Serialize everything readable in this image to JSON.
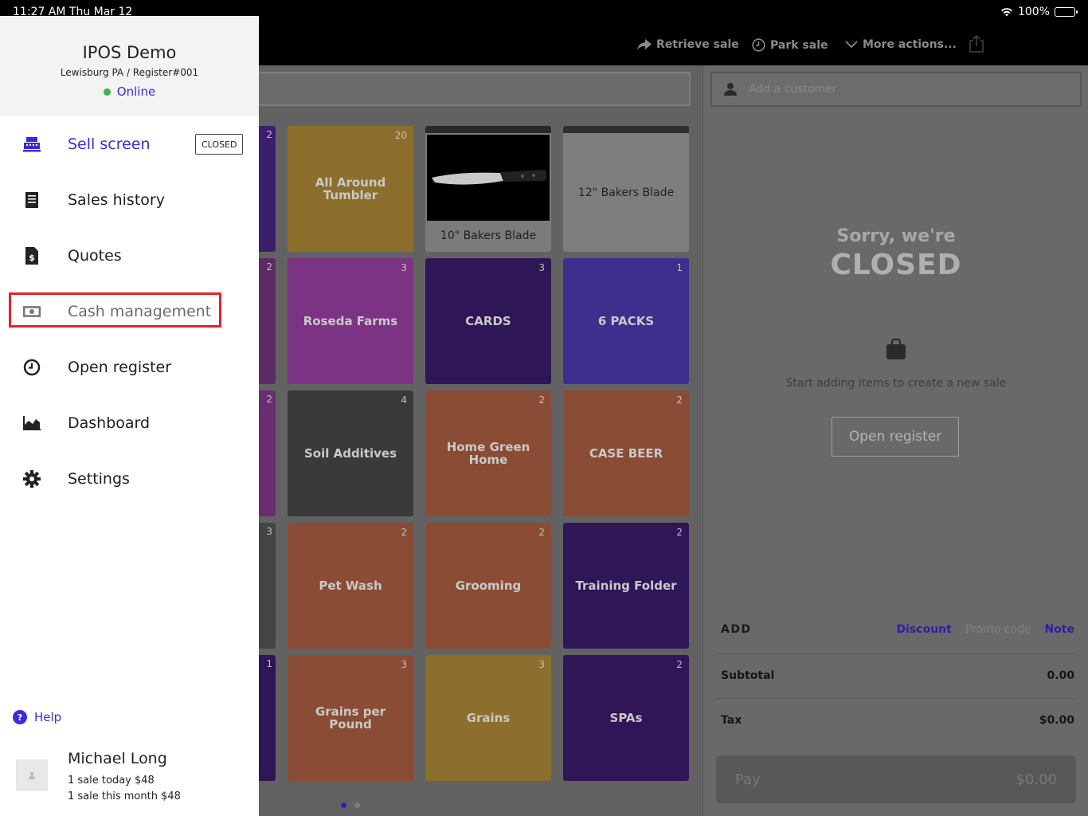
{
  "status_bar": {
    "time": "11:27 AM   Thu Mar 12",
    "battery": "100%"
  },
  "toolbar": {
    "retrieve_sale": "Retrieve sale",
    "park_sale": "Park sale",
    "more_actions": "More actions..."
  },
  "sidebar": {
    "store_name": "IPOS Demo",
    "store_location": "Lewisburg PA / Register#001",
    "status": "Online",
    "items": [
      {
        "label": "Sell screen",
        "icon": "register-icon",
        "badge": "CLOSED"
      },
      {
        "label": "Sales history",
        "icon": "receipt-icon"
      },
      {
        "label": "Quotes",
        "icon": "quote-document-icon"
      },
      {
        "label": "Cash management",
        "icon": "cash-icon"
      },
      {
        "label": "Open register",
        "icon": "clock-icon"
      },
      {
        "label": "Dashboard",
        "icon": "chart-icon"
      },
      {
        "label": "Settings",
        "icon": "gear-icon"
      }
    ],
    "help": "Help",
    "user": {
      "name": "Michael Long",
      "today": "1 sale today $48",
      "month": "1 sale this month $48"
    }
  },
  "edge_counts": [
    "2",
    "2",
    "2",
    "3",
    "1"
  ],
  "tiles": [
    {
      "label": "All Around Tumbler",
      "count": "20",
      "color": "#8c6f2c"
    },
    {
      "label": "10\" Bakers Blade",
      "count": "",
      "color": "#7b7b7b"
    },
    {
      "label": "12\" Bakers Blade",
      "count": "",
      "color": "#7e7e7e"
    },
    {
      "label": "Roseda Farms",
      "count": "3",
      "color": "#7d3384"
    },
    {
      "label": "CARDS",
      "count": "3",
      "color": "#2e1657"
    },
    {
      "label": "6 PACKS",
      "count": "1",
      "color": "#3c2f8e"
    },
    {
      "label": "Soil Additives",
      "count": "4",
      "color": "#3a3a3a"
    },
    {
      "label": "Home Green Home",
      "count": "2",
      "color": "#8a4c34"
    },
    {
      "label": "CASE BEER",
      "count": "2",
      "color": "#8a4c34"
    },
    {
      "label": "Pet Wash",
      "count": "2",
      "color": "#8a4c34"
    },
    {
      "label": "Grooming",
      "count": "2",
      "color": "#8a4c34"
    },
    {
      "label": "Training Folder",
      "count": "2",
      "color": "#2e1657"
    },
    {
      "label": "Grains per Pound",
      "count": "3",
      "color": "#8a4c34"
    },
    {
      "label": "Grains",
      "count": "3",
      "color": "#8c6f2c"
    },
    {
      "label": "SPAs",
      "count": "2",
      "color": "#2e1657"
    }
  ],
  "sale_panel": {
    "customer_placeholder": "Add a customer",
    "sorry": "Sorry, we're",
    "closed": "CLOSED",
    "hint": "Start adding items to create a new sale",
    "open_register": "Open register",
    "add": "ADD",
    "discount": "Discount",
    "promo_code": "Promo code",
    "note": "Note",
    "subtotal_label": "Subtotal",
    "subtotal_value": "0.00",
    "tax_label": "Tax",
    "tax_value": "$0.00",
    "pay_label": "Pay",
    "pay_value": "$0.00"
  }
}
